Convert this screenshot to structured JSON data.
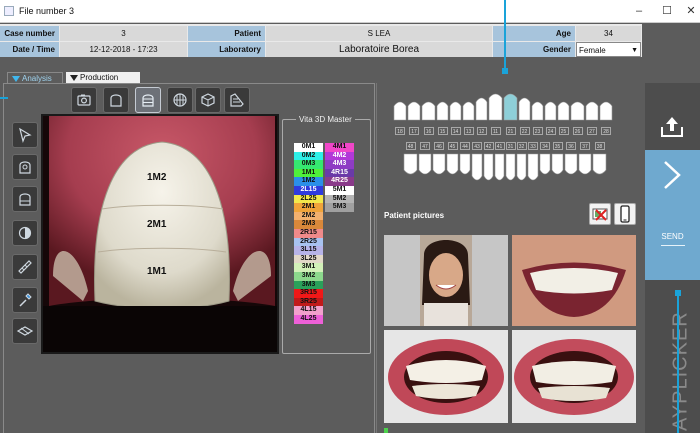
{
  "window": {
    "title": "File number 3",
    "minimize": "–",
    "maximize": "☐",
    "close": "✕"
  },
  "case_info": {
    "case_number_label": "Case number",
    "case_number": "3",
    "patient_label": "Patient",
    "patient": "S LEA",
    "age_label": "Age",
    "age": "34",
    "date_label": "Date / Time",
    "date": "12-12-2018 - 17:23",
    "laboratory_label": "Laboratory",
    "laboratory": "Laboratoire Borea",
    "gender_label": "Gender",
    "gender": "Female"
  },
  "tabs": [
    {
      "label": "Analysis",
      "selected": true
    },
    {
      "label": "Production",
      "selected": false
    }
  ],
  "toolbar_icons": [
    "camera-icon",
    "tooth-outline-icon",
    "tooth-zones-icon",
    "tooth-grid-icon",
    "tooth-3d-icon",
    "shade-guide-icon"
  ],
  "side_tools": [
    "pointer-icon",
    "tooth-circle-icon",
    "tooth-half-icon",
    "tooth-contrast-icon",
    "ruler-icon",
    "eyedropper-icon",
    "layers-icon"
  ],
  "tooth_zones": [
    "1M2",
    "2M1",
    "1M1"
  ],
  "vita": {
    "title": "Vita 3D Master",
    "left": [
      {
        "code": "0M1",
        "color": "#ffffff"
      },
      {
        "code": "0M2",
        "color": "#2ef0e8"
      },
      {
        "code": "0M3",
        "color": "#35e870"
      },
      {
        "code": "1M1",
        "color": "#4ff03a"
      },
      {
        "code": "1M2",
        "color": "#2b8fe8"
      },
      {
        "code": "2L15",
        "color": "#2f3bde"
      },
      {
        "code": "2L25",
        "color": "#f2e84b"
      },
      {
        "code": "2M1",
        "color": "#f0a43a"
      },
      {
        "code": "2M2",
        "color": "#f2b06e"
      },
      {
        "code": "2M3",
        "color": "#d9883a"
      },
      {
        "code": "2R15",
        "color": "#f08a8a"
      },
      {
        "code": "2R25",
        "color": "#a8c2f0"
      },
      {
        "code": "3L15",
        "color": "#b7b3e8"
      },
      {
        "code": "3L25",
        "color": "#e2d8c8"
      },
      {
        "code": "3M1",
        "color": "#d2f0b8"
      },
      {
        "code": "3M2",
        "color": "#8cd88c"
      },
      {
        "code": "3M3",
        "color": "#2aa05a"
      },
      {
        "code": "3R15",
        "color": "#f01818"
      },
      {
        "code": "3R25",
        "color": "#c01a1a"
      },
      {
        "code": "4L15",
        "color": "#f2a0cc"
      },
      {
        "code": "4L25",
        "color": "#ee60d8"
      }
    ],
    "right": [
      {
        "code": "4M1",
        "color": "#f046c8"
      },
      {
        "code": "4M2",
        "color": "#b238d8"
      },
      {
        "code": "4M3",
        "color": "#8e3cc4"
      },
      {
        "code": "4R15",
        "color": "#6a3aa8"
      },
      {
        "code": "4R25",
        "color": "#8a3a8a"
      },
      {
        "code": "5M1",
        "color": "#ffffff"
      },
      {
        "code": "5M2",
        "color": "#b4b4b4"
      },
      {
        "code": "5M3",
        "color": "#a0a0a0"
      }
    ]
  },
  "tooth_numbers_upper": [
    "18",
    "17",
    "16",
    "15",
    "14",
    "13",
    "12",
    "11",
    "21",
    "22",
    "23",
    "24",
    "25",
    "26",
    "27",
    "28"
  ],
  "tooth_numbers_lower": [
    "48",
    "47",
    "46",
    "45",
    "44",
    "43",
    "42",
    "41",
    "31",
    "32",
    "33",
    "34",
    "35",
    "36",
    "37",
    "38"
  ],
  "patient_pictures": {
    "title": "Patient pictures"
  },
  "sidebar": {
    "send_label": "SEND",
    "brand": "RAYPLICKER"
  }
}
